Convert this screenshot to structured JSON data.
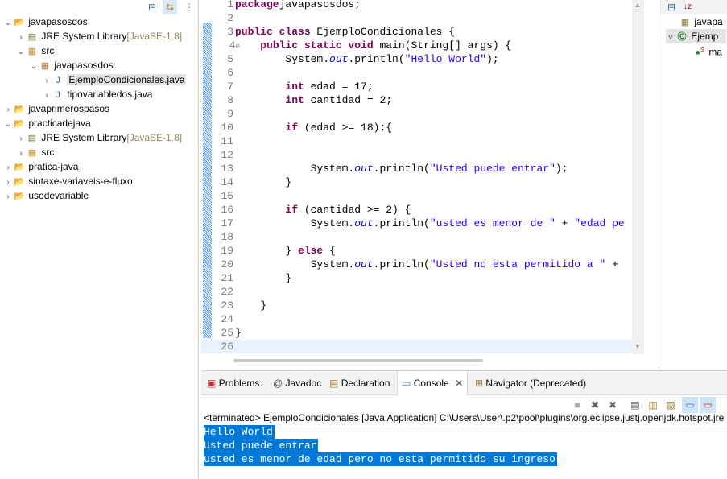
{
  "explorer": {
    "items": [
      {
        "label": "javapasosdos",
        "depth": 0,
        "tw": "v",
        "icon": "project-icon"
      },
      {
        "label": "JRE System Library",
        "dec": "[JavaSE-1.8]",
        "depth": 1,
        "tw": ">",
        "icon": "library-icon"
      },
      {
        "label": "src",
        "depth": 1,
        "tw": "v",
        "icon": "source-folder-icon"
      },
      {
        "label": "javapasosdos",
        "depth": 2,
        "tw": "v",
        "icon": "package-icon"
      },
      {
        "label": "EjemploCondicionales.java",
        "depth": 3,
        "tw": ">",
        "icon": "java-file-icon",
        "selected": true
      },
      {
        "label": "tipovariabledos.java",
        "depth": 3,
        "tw": ">",
        "icon": "java-file-icon"
      },
      {
        "label": "javaprimerospasos",
        "depth": 0,
        "tw": ">",
        "icon": "project-icon"
      },
      {
        "label": "practicadejava",
        "depth": 0,
        "tw": "v",
        "icon": "project-icon"
      },
      {
        "label": "JRE System Library",
        "dec": "[JavaSE-1.8]",
        "depth": 1,
        "tw": ">",
        "icon": "library-icon"
      },
      {
        "label": "src",
        "depth": 1,
        "tw": ">",
        "icon": "source-folder-icon"
      },
      {
        "label": "pratica-java",
        "depth": 0,
        "tw": ">",
        "icon": "project-icon"
      },
      {
        "label": "sintaxe-variaveis-e-fluxo",
        "depth": 0,
        "tw": ">",
        "icon": "project-icon"
      },
      {
        "label": "usodevariable",
        "depth": 0,
        "tw": ">",
        "icon": "project-icon"
      }
    ]
  },
  "editor": {
    "lines": [
      [
        [
          "kw",
          "package"
        ],
        [
          "",
          "javapasosdos;"
        ]
      ],
      [],
      [
        [
          "kw",
          "public class"
        ],
        [
          "",
          " EjemploCondicionales {"
        ]
      ],
      [
        [
          "",
          "    "
        ],
        [
          "kw",
          "public static void"
        ],
        [
          "",
          " main(String[] args) {"
        ]
      ],
      [
        [
          "",
          "        System."
        ],
        [
          "fd",
          "out"
        ],
        [
          "",
          ".println("
        ],
        [
          "st",
          "\"Hello World\""
        ],
        [
          "",
          ");"
        ]
      ],
      [],
      [
        [
          "",
          "        "
        ],
        [
          "kw",
          "int"
        ],
        [
          "",
          " edad = 17;"
        ]
      ],
      [
        [
          "",
          "        "
        ],
        [
          "kw",
          "int"
        ],
        [
          "",
          " cantidad = 2;"
        ]
      ],
      [],
      [
        [
          "",
          "        "
        ],
        [
          "kw",
          "if"
        ],
        [
          "",
          " (edad >= 18);{"
        ]
      ],
      [],
      [],
      [
        [
          "",
          "            System."
        ],
        [
          "fd",
          "out"
        ],
        [
          "",
          ".println("
        ],
        [
          "st",
          "\"Usted puede entrar\""
        ],
        [
          "",
          ");"
        ]
      ],
      [
        [
          "",
          "        }"
        ]
      ],
      [],
      [
        [
          "",
          "        "
        ],
        [
          "kw",
          "if"
        ],
        [
          "",
          " (cantidad >= 2) {"
        ]
      ],
      [
        [
          "",
          "            System."
        ],
        [
          "fd",
          "out"
        ],
        [
          "",
          ".println("
        ],
        [
          "st",
          "\"usted es menor de \""
        ],
        [
          "",
          " + "
        ],
        [
          "st",
          "\"edad pe"
        ]
      ],
      [],
      [
        [
          "",
          "        } "
        ],
        [
          "kw",
          "else"
        ],
        [
          "",
          " {"
        ]
      ],
      [
        [
          "",
          "            System."
        ],
        [
          "fd",
          "out"
        ],
        [
          "",
          ".println("
        ],
        [
          "st",
          "\"Usted no esta permitido a \""
        ],
        [
          "",
          " +"
        ]
      ],
      [
        [
          "",
          "        }"
        ]
      ],
      [],
      [
        [
          "",
          "    }"
        ]
      ],
      [],
      [
        [
          "",
          "}"
        ]
      ],
      []
    ]
  },
  "outline": {
    "items": [
      "javapa",
      "Ejemp",
      "ma"
    ]
  },
  "bottom": {
    "tabs": [
      "Problems",
      "Javadoc",
      "Declaration",
      "Console",
      "Navigator (Deprecated)"
    ],
    "terminated": "<terminated> EjemploCondicionales [Java Application] C:\\Users\\User\\.p2\\pool\\plugins\\org.eclipse.justj.openjdk.hotspot.jre",
    "output": [
      "Hello World",
      "Usted puede entrar",
      "usted es menor de edad pero no esta permitido su ingreso"
    ]
  },
  "colors": {
    "keyword": "#7f0055",
    "string": "#2a00ff",
    "field": "#0000c0",
    "selection": "#0078d7"
  }
}
